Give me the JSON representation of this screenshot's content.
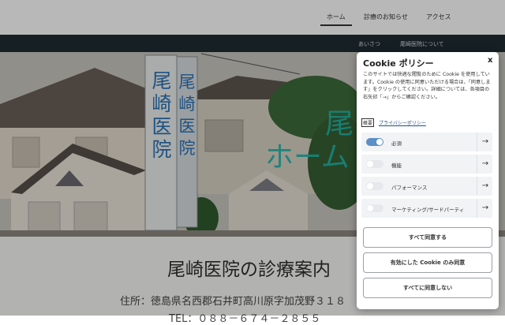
{
  "nav": {
    "home": "ホーム",
    "news": "診療のお知らせ",
    "access": "アクセス"
  },
  "subnav": {
    "greeting": "あいさつ",
    "about": "尾崎医院について"
  },
  "hero": {
    "line1": "尾",
    "line2": "ホーム",
    "sign_left": "尾崎医院",
    "sign_right": "尾崎医院",
    "color": "#21b5a9"
  },
  "content": {
    "title": "尾崎医院の診療案内",
    "address": "住所：徳島県名西郡石井町高川原字加茂野３１８",
    "tel": "TEL：０８８－６７４－２８５５"
  },
  "cookie": {
    "title": "Cookie ポリシー",
    "close": "x",
    "description": "このサイトでは快適な閲覧のために Cookie を使用しています。Cookie の使用に同意いただける場合は、「同意します」をクリックしてください。詳細については、各項目の右矢印「→」からご確認ください。",
    "tab_summary": "概要",
    "tab_privacy": "プライバシーポリシー",
    "categories": [
      {
        "label": "必須",
        "enabled": true
      },
      {
        "label": "機能",
        "enabled": false
      },
      {
        "label": "パフォーマンス",
        "enabled": false
      },
      {
        "label": "マーケティング/サードパーティ",
        "enabled": false
      }
    ],
    "arrow": "→",
    "accept_all": "すべて同意する",
    "accept_enabled": "有効にした Cookie のみ同意",
    "reject_all": "すべてに同意しない",
    "toggle_on_color": "#5b8fc6"
  }
}
